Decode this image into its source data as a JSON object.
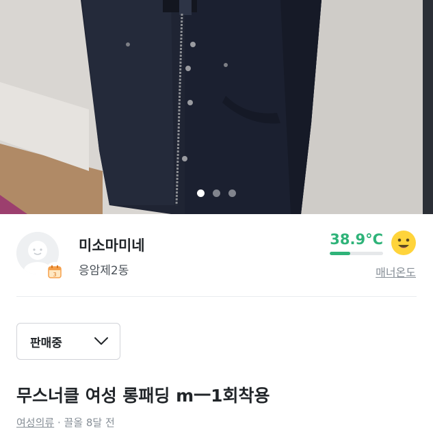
{
  "photo": {
    "carousel_total": 3,
    "carousel_active_index": 0
  },
  "seller": {
    "nickname": "미소마미네",
    "region": "응암제2동",
    "manner_temperature": "38.9°C",
    "manner_temperature_level": 0.389,
    "manner_label": "매너온도",
    "temperature_color": "#2fb379"
  },
  "product": {
    "status": "판매중",
    "title": "무스너클 여성 롱패딩 m一1회착용",
    "category": "여성의류",
    "separator": " · ",
    "bump_time": "끌올 8달 전"
  },
  "icons": {
    "avatar": "default-user-avatar-icon",
    "badge": "calendar-badge-icon",
    "smiley": "smiley-face-icon",
    "dropdown": "chevron-down-icon"
  }
}
